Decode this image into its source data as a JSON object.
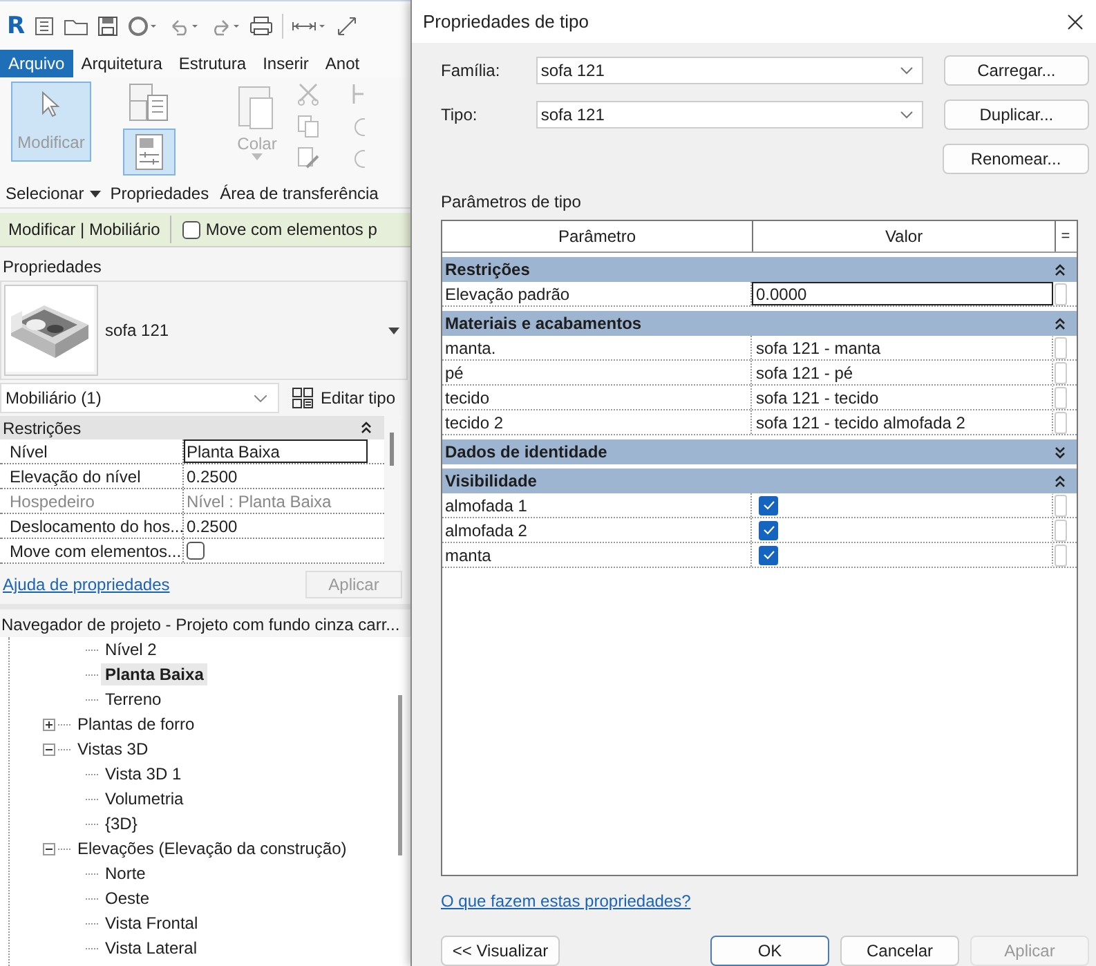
{
  "app": {
    "logo": "R"
  },
  "ribbon": {
    "tabs": [
      {
        "label": "Arquivo",
        "selected": true
      },
      {
        "label": "Arquitetura",
        "selected": false
      },
      {
        "label": "Estrutura",
        "selected": false
      },
      {
        "label": "Inserir",
        "selected": false
      },
      {
        "label": "Anot",
        "selected": false
      }
    ],
    "modify_tool": {
      "label": "Modificar",
      "selected": true
    },
    "properties_tool": {
      "selected": true
    },
    "paste_tool": {
      "label": "Colar"
    },
    "panel_labels": [
      "Selecionar",
      "Propriedades",
      "Área de transferência"
    ]
  },
  "context_bar": {
    "title": "Modificar | Mobiliário",
    "option": {
      "label": "Move com elementos p",
      "checked": false
    }
  },
  "properties": {
    "title": "Propriedades",
    "type_name": "sofa 121",
    "filter": "Mobiliário (1)",
    "edit_type": "Editar tipo",
    "group": {
      "name": "Restrições",
      "expanded": true
    },
    "rows": [
      {
        "label": "Nível",
        "kind": "text",
        "value": "Planta Baixa",
        "editing": true,
        "disabled": false
      },
      {
        "label": "Elevação do nível",
        "kind": "text",
        "value": "0.2500",
        "editing": false,
        "disabled": false
      },
      {
        "label": "Hospedeiro",
        "kind": "text",
        "value": "Nível : Planta Baixa",
        "editing": false,
        "disabled": true
      },
      {
        "label": "Deslocamento do hos...",
        "kind": "text",
        "value": "0.2500",
        "editing": false,
        "disabled": false
      },
      {
        "label": "Move com elementos...",
        "kind": "checkbox",
        "checked": false,
        "editing": false,
        "disabled": false
      }
    ],
    "help_link": "Ajuda de propriedades",
    "apply": {
      "label": "Aplicar",
      "disabled": true
    }
  },
  "browser": {
    "title": "Navegador de projeto - Projeto com fundo cinza carr...",
    "continued_items": [
      {
        "label": "Nível 2",
        "selected": false
      },
      {
        "label": "Planta Baixa",
        "selected": true
      },
      {
        "label": "Terreno",
        "selected": false
      }
    ],
    "tree": [
      {
        "label": "Plantas de forro",
        "selected": false,
        "expanded": false
      },
      {
        "label": "Vistas 3D",
        "selected": false,
        "expanded": true,
        "children": [
          {
            "label": "Vista 3D 1",
            "selected": false
          },
          {
            "label": "Volumetria",
            "selected": false
          },
          {
            "label": "{3D}",
            "selected": false
          }
        ]
      },
      {
        "label": "Elevações (Elevação da construção)",
        "selected": false,
        "expanded": true,
        "children": [
          {
            "label": "Norte",
            "selected": false
          },
          {
            "label": "Oeste",
            "selected": false
          },
          {
            "label": "Vista Frontal",
            "selected": false
          },
          {
            "label": "Vista Lateral",
            "selected": false
          }
        ]
      }
    ]
  },
  "dialog": {
    "title": "Propriedades de tipo",
    "fields": [
      {
        "label": "Família:",
        "value": "sofa 121",
        "button": "Carregar..."
      },
      {
        "label": "Tipo:",
        "value": "sofa 121",
        "button": "Duplicar..."
      }
    ],
    "rename_button": "Renomear...",
    "section_label": "Parâmetros de tipo",
    "columns": [
      "Parâmetro",
      "Valor",
      "="
    ],
    "groups": [
      {
        "name": "Restrições",
        "expanded": true,
        "rows": [
          {
            "name": "Elevação padrão",
            "kind": "text",
            "value": "0.0000",
            "editing": true
          }
        ]
      },
      {
        "name": "Materiais e acabamentos",
        "expanded": true,
        "rows": [
          {
            "name": "manta.",
            "kind": "text",
            "value": "sofa 121 - manta",
            "editing": false
          },
          {
            "name": "pé",
            "kind": "text",
            "value": "sofa 121 - pé",
            "editing": false
          },
          {
            "name": "tecido",
            "kind": "text",
            "value": "sofa 121 - tecido",
            "editing": false
          },
          {
            "name": "tecido 2",
            "kind": "text",
            "value": "sofa 121 - tecido almofada 2",
            "editing": false
          }
        ]
      },
      {
        "name": "Dados de identidade",
        "expanded": false
      },
      {
        "name": "Visibilidade",
        "expanded": true,
        "rows": [
          {
            "name": "almofada 1",
            "kind": "checkbox",
            "checked": true,
            "editing": false
          },
          {
            "name": "almofada 2",
            "kind": "checkbox",
            "checked": true,
            "editing": false
          },
          {
            "name": "manta",
            "kind": "checkbox",
            "checked": true,
            "editing": false
          }
        ]
      }
    ],
    "help_link": "O que fazem estas propriedades?",
    "buttons": [
      {
        "label": "<< Visualizar",
        "kind": "preview",
        "disabled": false
      },
      {
        "label": "OK",
        "kind": "default",
        "disabled": false
      },
      {
        "label": "Cancelar",
        "kind": "normal",
        "disabled": false
      },
      {
        "label": "Aplicar",
        "kind": "normal",
        "disabled": true
      }
    ]
  }
}
